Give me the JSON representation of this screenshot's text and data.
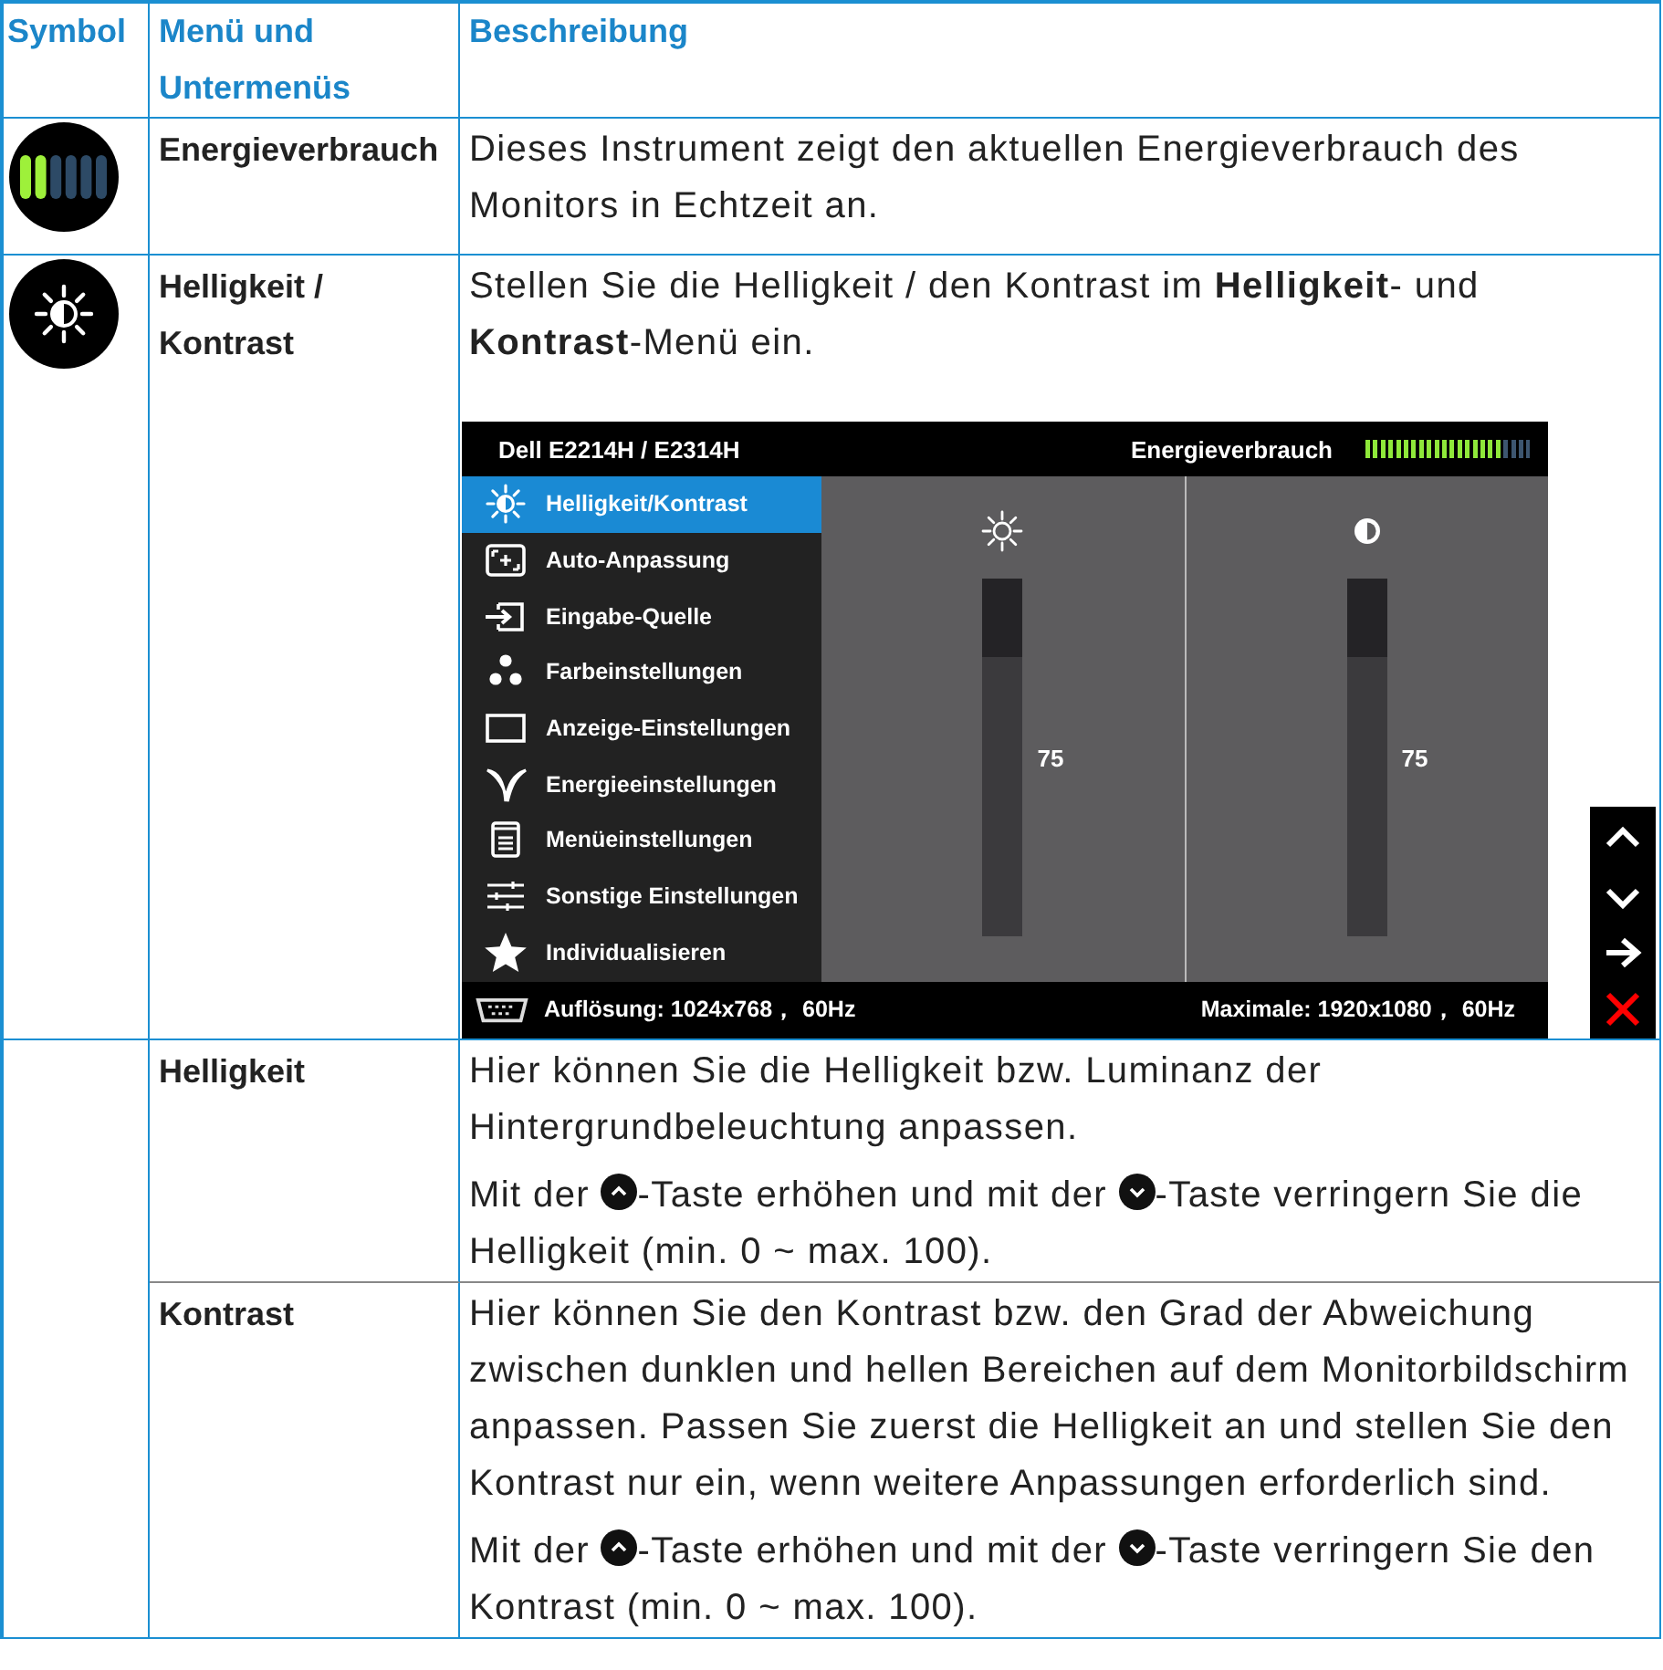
{
  "table": {
    "columns": [
      "Symbol",
      "Menü und Untermenüs",
      "Beschreibung"
    ],
    "rows": [
      {
        "kind": "energy",
        "menu": "Energieverbrauch",
        "paragraphs": [
          [
            [
              {
                "kind": "text",
                "text": "Dieses Instrument zeigt den aktuellen Energieverbrauch des Monitors in Echtzeit an."
              }
            ]
          ]
        ]
      },
      {
        "kind": "brightness",
        "menu": "Helligkeit / Kontrast",
        "paragraphs": [
          [
            [
              {
                "kind": "text",
                "text": "Stellen Sie die Helligkeit / den Kontrast im **Helligkeit**- und **Kontrast**-Menü ein."
              }
            ]
          ]
        ],
        "osd": {
          "title": "Dell E2214H / E2314H",
          "energy_meter": {
            "label": "Energieverbrauch",
            "level": 0.82
          },
          "menu": [
            {
              "kind": "brightness",
              "label": "Helligkeit/Kontrast",
              "selected": true
            },
            {
              "kind": "auto",
              "label": "Auto-Anpassung",
              "selected": false
            },
            {
              "kind": "input",
              "label": "Eingabe-Quelle",
              "selected": false
            },
            {
              "kind": "color",
              "label": "Farbeinstellungen",
              "selected": false
            },
            {
              "kind": "display",
              "label": "Anzeige-Einstellungen",
              "selected": false
            },
            {
              "kind": "energy",
              "label": "Energieeinstellungen",
              "selected": false
            },
            {
              "kind": "menu",
              "label": "Menüeinstellungen",
              "selected": false
            },
            {
              "kind": "other",
              "label": "Sonstige Einstellungen",
              "selected": false
            },
            {
              "kind": "star",
              "label": "Individualisieren",
              "selected": false
            }
          ],
          "sliders": [
            {
              "kind": "brightness",
              "level": 0.78,
              "value": "75"
            },
            {
              "kind": "contrast",
              "level": 0.78,
              "value": "75"
            }
          ],
          "resolution": "Auflösung: 1024x768，  60Hz",
          "maximum": "Maximale: 1920x1080，  60Hz"
        },
        "side_buttons": [
          {
            "kind": "up"
          },
          {
            "kind": "down"
          },
          {
            "kind": "enter"
          },
          {
            "kind": "exit"
          }
        ]
      },
      {
        "kind": "submenus",
        "submenus": [
          {
            "menu": "Helligkeit",
            "paragraphs": [
              [
                [
                  {
                    "kind": "text",
                    "text": "Hier können Sie die Helligkeit bzw. Luminanz der Hintergrundbeleuchtung anpassen."
                  }
                ]
              ],
              [
                [
                  {
                    "kind": "text",
                    "text": "Mit der "
                  },
                  {
                    "kind": "up_key"
                  },
                  {
                    "kind": "text",
                    "text": "-Taste erhöhen und mit der "
                  },
                  {
                    "kind": "down_key"
                  },
                  {
                    "kind": "text",
                    "text": "-Taste verringern Sie die"
                  }
                ],
                [
                  {
                    "kind": "text",
                    "text": "Helligkeit (min. 0 ~ max. 100)."
                  }
                ]
              ]
            ]
          },
          {
            "menu": "Kontrast",
            "paragraphs": [
              [
                [
                  {
                    "kind": "text",
                    "text": "Hier können Sie den Kontrast bzw. den Grad der Abweichung zwischen dunklen und hellen Bereichen auf dem Monitorbildschirm anpassen. Passen Sie zuerst die Helligkeit an und stellen Sie den Kontrast nur ein, wenn weitere Anpassungen erforderlich sind."
                  }
                ]
              ],
              [
                [
                  {
                    "kind": "text",
                    "text": "Mit der "
                  },
                  {
                    "kind": "up_key"
                  },
                  {
                    "kind": "text",
                    "text": "-Taste erhöhen und mit der "
                  },
                  {
                    "kind": "down_key"
                  },
                  {
                    "kind": "text",
                    "text": "-Taste verringern Sie den"
                  }
                ],
                [
                  {
                    "kind": "text",
                    "text": "Kontrast (min. 0 ~ max. 100)."
                  }
                ]
              ]
            ]
          }
        ]
      }
    ]
  }
}
